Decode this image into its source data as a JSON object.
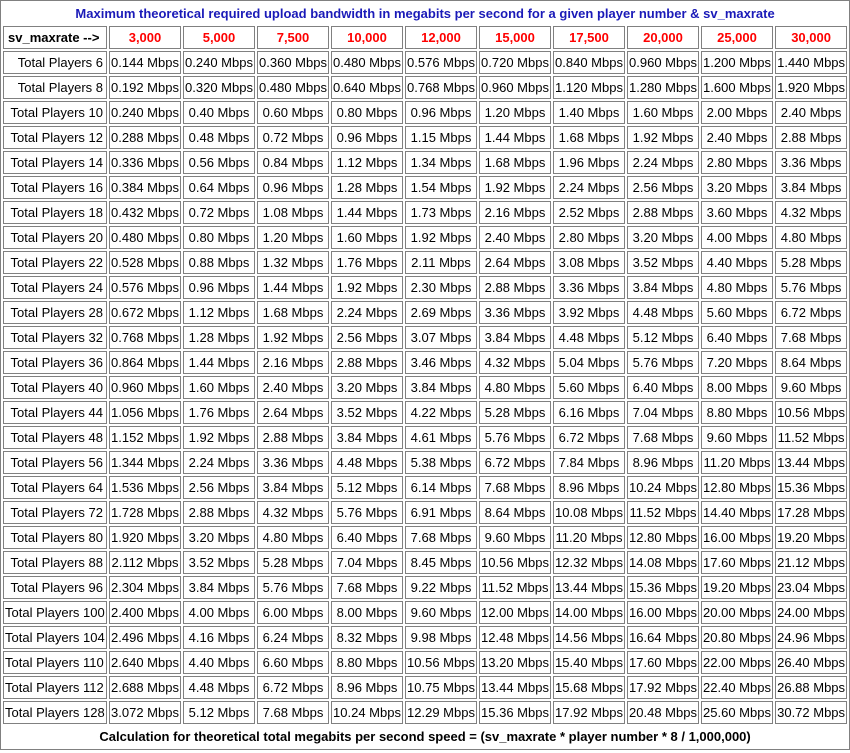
{
  "title": "Maximum theoretical required upload bandwidth in megabits per second for a given player number & sv_maxrate",
  "header": {
    "label": "sv_maxrate -->",
    "rates": [
      "3,000",
      "5,000",
      "7,500",
      "10,000",
      "12,000",
      "15,000",
      "17,500",
      "20,000",
      "25,000",
      "30,000"
    ]
  },
  "rows": [
    {
      "label": "Total Players 6",
      "values": [
        "0.144 Mbps",
        "0.240 Mbps",
        "0.360 Mbps",
        "0.480 Mbps",
        "0.576 Mbps",
        "0.720 Mbps",
        "0.840 Mbps",
        "0.960 Mbps",
        "1.200 Mbps",
        "1.440 Mbps"
      ]
    },
    {
      "label": "Total Players 8",
      "values": [
        "0.192 Mbps",
        "0.320 Mbps",
        "0.480 Mbps",
        "0.640 Mbps",
        "0.768 Mbps",
        "0.960 Mbps",
        "1.120 Mbps",
        "1.280 Mbps",
        "1.600 Mbps",
        "1.920 Mbps"
      ]
    },
    {
      "label": "Total Players 10",
      "values": [
        "0.240 Mbps",
        "0.40 Mbps",
        "0.60 Mbps",
        "0.80 Mbps",
        "0.96 Mbps",
        "1.20 Mbps",
        "1.40 Mbps",
        "1.60 Mbps",
        "2.00 Mbps",
        "2.40 Mbps"
      ]
    },
    {
      "label": "Total Players 12",
      "values": [
        "0.288 Mbps",
        "0.48 Mbps",
        "0.72 Mbps",
        "0.96 Mbps",
        "1.15 Mbps",
        "1.44 Mbps",
        "1.68 Mbps",
        "1.92 Mbps",
        "2.40 Mbps",
        "2.88 Mbps"
      ]
    },
    {
      "label": "Total Players 14",
      "values": [
        "0.336 Mbps",
        "0.56 Mbps",
        "0.84 Mbps",
        "1.12 Mbps",
        "1.34 Mbps",
        "1.68 Mbps",
        "1.96 Mbps",
        "2.24 Mbps",
        "2.80 Mbps",
        "3.36 Mbps"
      ]
    },
    {
      "label": "Total Players 16",
      "values": [
        "0.384 Mbps",
        "0.64 Mbps",
        "0.96 Mbps",
        "1.28 Mbps",
        "1.54 Mbps",
        "1.92 Mbps",
        "2.24 Mbps",
        "2.56 Mbps",
        "3.20 Mbps",
        "3.84 Mbps"
      ]
    },
    {
      "label": "Total Players 18",
      "values": [
        "0.432 Mbps",
        "0.72 Mbps",
        "1.08 Mbps",
        "1.44 Mbps",
        "1.73 Mbps",
        "2.16 Mbps",
        "2.52 Mbps",
        "2.88 Mbps",
        "3.60 Mbps",
        "4.32 Mbps"
      ]
    },
    {
      "label": "Total Players 20",
      "values": [
        "0.480 Mbps",
        "0.80 Mbps",
        "1.20 Mbps",
        "1.60 Mbps",
        "1.92 Mbps",
        "2.40 Mbps",
        "2.80 Mbps",
        "3.20 Mbps",
        "4.00 Mbps",
        "4.80 Mbps"
      ]
    },
    {
      "label": "Total Players 22",
      "values": [
        "0.528 Mbps",
        "0.88 Mbps",
        "1.32 Mbps",
        "1.76 Mbps",
        "2.11 Mbps",
        "2.64 Mbps",
        "3.08 Mbps",
        "3.52 Mbps",
        "4.40 Mbps",
        "5.28 Mbps"
      ]
    },
    {
      "label": "Total Players 24",
      "values": [
        "0.576 Mbps",
        "0.96 Mbps",
        "1.44 Mbps",
        "1.92 Mbps",
        "2.30 Mbps",
        "2.88 Mbps",
        "3.36 Mbps",
        "3.84 Mbps",
        "4.80 Mbps",
        "5.76 Mbps"
      ]
    },
    {
      "label": "Total Players 28",
      "values": [
        "0.672 Mbps",
        "1.12 Mbps",
        "1.68 Mbps",
        "2.24 Mbps",
        "2.69 Mbps",
        "3.36 Mbps",
        "3.92 Mbps",
        "4.48 Mbps",
        "5.60 Mbps",
        "6.72 Mbps"
      ]
    },
    {
      "label": "Total Players 32",
      "values": [
        "0.768 Mbps",
        "1.28 Mbps",
        "1.92 Mbps",
        "2.56 Mbps",
        "3.07 Mbps",
        "3.84 Mbps",
        "4.48 Mbps",
        "5.12 Mbps",
        "6.40 Mbps",
        "7.68 Mbps"
      ]
    },
    {
      "label": "Total Players 36",
      "values": [
        "0.864 Mbps",
        "1.44 Mbps",
        "2.16 Mbps",
        "2.88 Mbps",
        "3.46 Mbps",
        "4.32 Mbps",
        "5.04 Mbps",
        "5.76 Mbps",
        "7.20 Mbps",
        "8.64 Mbps"
      ]
    },
    {
      "label": "Total Players 40",
      "values": [
        "0.960 Mbps",
        "1.60 Mbps",
        "2.40 Mbps",
        "3.20 Mbps",
        "3.84 Mbps",
        "4.80 Mbps",
        "5.60 Mbps",
        "6.40 Mbps",
        "8.00 Mbps",
        "9.60 Mbps"
      ]
    },
    {
      "label": "Total Players 44",
      "values": [
        "1.056 Mbps",
        "1.76 Mbps",
        "2.64 Mbps",
        "3.52 Mbps",
        "4.22 Mbps",
        "5.28 Mbps",
        "6.16 Mbps",
        "7.04 Mbps",
        "8.80 Mbps",
        "10.56 Mbps"
      ]
    },
    {
      "label": "Total Players 48",
      "values": [
        "1.152 Mbps",
        "1.92 Mbps",
        "2.88 Mbps",
        "3.84 Mbps",
        "4.61 Mbps",
        "5.76 Mbps",
        "6.72 Mbps",
        "7.68 Mbps",
        "9.60 Mbps",
        "11.52 Mbps"
      ]
    },
    {
      "label": "Total Players 56",
      "values": [
        "1.344 Mbps",
        "2.24 Mbps",
        "3.36 Mbps",
        "4.48 Mbps",
        "5.38 Mbps",
        "6.72 Mbps",
        "7.84 Mbps",
        "8.96 Mbps",
        "11.20 Mbps",
        "13.44 Mbps"
      ]
    },
    {
      "label": "Total Players 64",
      "values": [
        "1.536 Mbps",
        "2.56 Mbps",
        "3.84 Mbps",
        "5.12 Mbps",
        "6.14 Mbps",
        "7.68 Mbps",
        "8.96 Mbps",
        "10.24 Mbps",
        "12.80 Mbps",
        "15.36 Mbps"
      ]
    },
    {
      "label": "Total Players 72",
      "values": [
        "1.728 Mbps",
        "2.88 Mbps",
        "4.32 Mbps",
        "5.76 Mbps",
        "6.91 Mbps",
        "8.64 Mbps",
        "10.08 Mbps",
        "11.52 Mbps",
        "14.40 Mbps",
        "17.28 Mbps"
      ]
    },
    {
      "label": "Total Players 80",
      "values": [
        "1.920 Mbps",
        "3.20 Mbps",
        "4.80 Mbps",
        "6.40 Mbps",
        "7.68 Mbps",
        "9.60 Mbps",
        "11.20 Mbps",
        "12.80 Mbps",
        "16.00 Mbps",
        "19.20 Mbps"
      ]
    },
    {
      "label": "Total Players 88",
      "values": [
        "2.112 Mbps",
        "3.52 Mbps",
        "5.28 Mbps",
        "7.04 Mbps",
        "8.45 Mbps",
        "10.56 Mbps",
        "12.32 Mbps",
        "14.08 Mbps",
        "17.60 Mbps",
        "21.12 Mbps"
      ]
    },
    {
      "label": "Total Players 96",
      "values": [
        "2.304 Mbps",
        "3.84 Mbps",
        "5.76 Mbps",
        "7.68 Mbps",
        "9.22 Mbps",
        "11.52 Mbps",
        "13.44 Mbps",
        "15.36 Mbps",
        "19.20 Mbps",
        "23.04 Mbps"
      ]
    },
    {
      "label": "Total Players 100",
      "values": [
        "2.400 Mbps",
        "4.00 Mbps",
        "6.00 Mbps",
        "8.00 Mbps",
        "9.60 Mbps",
        "12.00 Mbps",
        "14.00 Mbps",
        "16.00 Mbps",
        "20.00 Mbps",
        "24.00 Mbps"
      ]
    },
    {
      "label": "Total Players 104",
      "values": [
        "2.496 Mbps",
        "4.16 Mbps",
        "6.24 Mbps",
        "8.32 Mbps",
        "9.98 Mbps",
        "12.48 Mbps",
        "14.56 Mbps",
        "16.64 Mbps",
        "20.80 Mbps",
        "24.96 Mbps"
      ]
    },
    {
      "label": "Total Players 110",
      "values": [
        "2.640 Mbps",
        "4.40 Mbps",
        "6.60 Mbps",
        "8.80 Mbps",
        "10.56 Mbps",
        "13.20 Mbps",
        "15.40 Mbps",
        "17.60 Mbps",
        "22.00 Mbps",
        "26.40 Mbps"
      ]
    },
    {
      "label": "Total Players 112",
      "values": [
        "2.688 Mbps",
        "4.48 Mbps",
        "6.72 Mbps",
        "8.96 Mbps",
        "10.75 Mbps",
        "13.44 Mbps",
        "15.68 Mbps",
        "17.92 Mbps",
        "22.40 Mbps",
        "26.88 Mbps"
      ]
    },
    {
      "label": "Total Players 128",
      "values": [
        "3.072 Mbps",
        "5.12 Mbps",
        "7.68 Mbps",
        "10.24 Mbps",
        "12.29 Mbps",
        "15.36 Mbps",
        "17.92 Mbps",
        "20.48 Mbps",
        "25.60 Mbps",
        "30.72 Mbps"
      ]
    }
  ],
  "footer": "Calculation for theoretical total megabits per second speed = (sv_maxrate * player number * 8 / 1,000,000)",
  "colors": {
    "title": "#1a1ab8",
    "rate_header": "#ff0000",
    "border": "#808080"
  }
}
